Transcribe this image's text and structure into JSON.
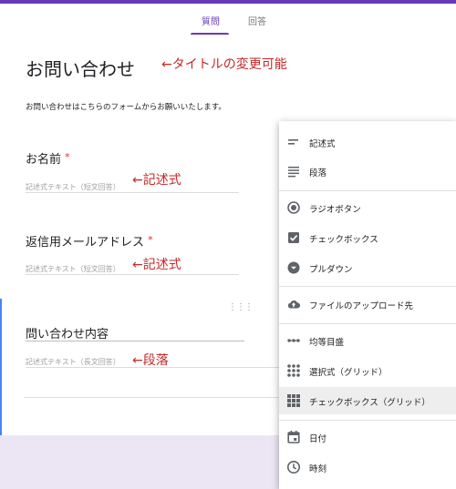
{
  "tabs": [
    {
      "label": "質問",
      "active": true
    },
    {
      "label": "回答",
      "active": false
    }
  ],
  "form": {
    "title": "お問い合わせ",
    "title_annotation": "←タイトルの変更可能",
    "description": "お問い合わせはこちらのフォームからお願いいたします。"
  },
  "questions": [
    {
      "title": "お名前",
      "required": "*",
      "hint": "記述式テキスト（短文回答）",
      "annotation": "←記述式"
    },
    {
      "title": "返信用メールアドレス",
      "required": "*",
      "hint": "記述式テキスト（短文回答）",
      "annotation": "←記述式"
    },
    {
      "title": "問い合わせ内容",
      "required": "",
      "hint": "記述式テキスト（長文回答）",
      "annotation": "←段落"
    }
  ],
  "active_card": {
    "drag_handle": "⋮⋮⋮"
  },
  "type_menu": {
    "items": [
      {
        "label": "記述式",
        "icon": "short-answer-icon"
      },
      {
        "label": "段落",
        "icon": "paragraph-icon"
      },
      {
        "label": "ラジオボタン",
        "icon": "radio-button-icon"
      },
      {
        "label": "チェックボックス",
        "icon": "checkbox-icon"
      },
      {
        "label": "プルダウン",
        "icon": "dropdown-icon"
      },
      {
        "label": "ファイルのアップロード先",
        "icon": "cloud-upload-icon"
      },
      {
        "label": "均等目盛",
        "icon": "linear-scale-icon"
      },
      {
        "label": "選択式（グリッド）",
        "icon": "grid-icon"
      },
      {
        "label": "チェックボックス（グリッド）",
        "icon": "checkbox-grid-icon",
        "highlighted": true
      },
      {
        "label": "日付",
        "icon": "calendar-icon"
      },
      {
        "label": "時刻",
        "icon": "clock-icon"
      }
    ]
  },
  "colors": {
    "accent": "#673ab7",
    "annotation": "#c62828",
    "focus": "#4285f4",
    "icon": "#5f6368"
  }
}
